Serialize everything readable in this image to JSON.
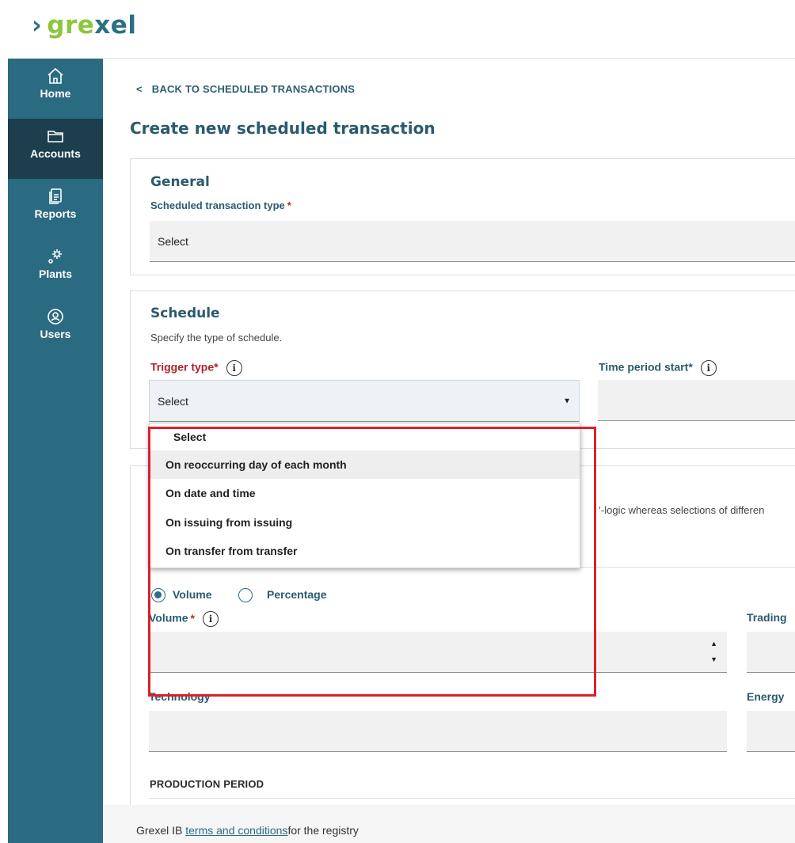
{
  "brand": {
    "chev": "›",
    "g": "gre",
    "x": "xel"
  },
  "sidebar": {
    "items": [
      {
        "label": "Home",
        "icon": "home-icon"
      },
      {
        "label": "Accounts",
        "icon": "folder-icon"
      },
      {
        "label": "Reports",
        "icon": "report-icon"
      },
      {
        "label": "Plants",
        "icon": "gears-icon"
      },
      {
        "label": "Users",
        "icon": "user-circle-icon"
      }
    ],
    "active": "Accounts"
  },
  "back": {
    "arrow": "<",
    "label": "BACK TO SCHEDULED TRANSACTIONS"
  },
  "page_title": "Create new scheduled transaction",
  "general": {
    "title": "General",
    "type_label": "Scheduled transaction type",
    "req": "*",
    "type_value": "Select"
  },
  "schedule": {
    "title": "Schedule",
    "description": "Specify the type of schedule.",
    "trigger_label": "Trigger type",
    "trigger_req": "*",
    "trigger_value": "Select",
    "start_label": "Time period start",
    "start_req": "*",
    "info_glyph": "i"
  },
  "dropdown": {
    "options": [
      "Select",
      "On reoccurring day of each month",
      "On date and time",
      "On issuing from issuing",
      "On transfer from transfer"
    ],
    "hovered": 1
  },
  "partial_text": "’-logic whereas selections of differen",
  "amount": {
    "radio_volume": "Volume",
    "radio_percentage": "Percentage",
    "selected": "Volume",
    "volume_label": "Volume",
    "volume_req": "*",
    "trading_label": "Trading",
    "technology_label": "Technology",
    "energy_label": "Energy"
  },
  "production_period": "PRODUCTION PERIOD",
  "footer": {
    "prefix": "Grexel IB ",
    "link": "terms and conditions",
    "suffix": "for the registry"
  },
  "colors": {
    "sidebar": "#2b6b82",
    "sidebar_active": "#1c3e4d",
    "accent": "#2b5a6e",
    "logo_green": "#8cc63f",
    "highlight": "#e01e2b"
  }
}
